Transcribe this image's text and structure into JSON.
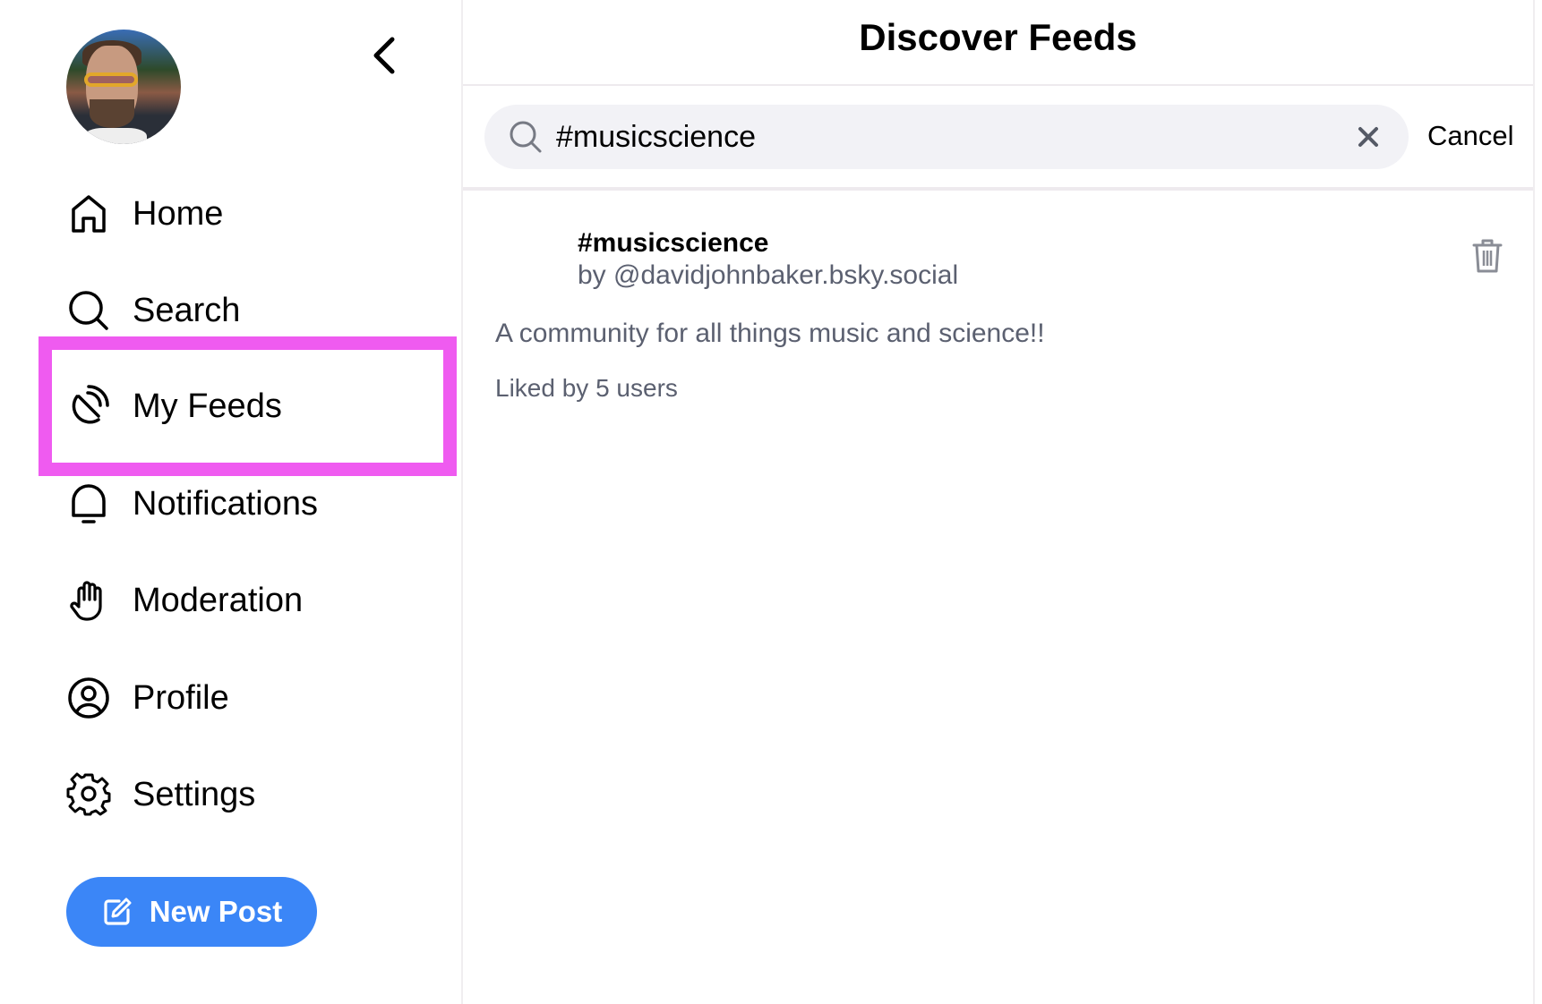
{
  "sidebar": {
    "nav": [
      {
        "label": "Home",
        "icon": "home-icon"
      },
      {
        "label": "Search",
        "icon": "search-icon"
      },
      {
        "label": "My Feeds",
        "icon": "feeds-icon"
      },
      {
        "label": "Notifications",
        "icon": "bell-icon"
      },
      {
        "label": "Moderation",
        "icon": "hand-icon"
      },
      {
        "label": "Profile",
        "icon": "user-circle-icon"
      },
      {
        "label": "Settings",
        "icon": "gear-icon"
      }
    ],
    "new_post_label": "New Post",
    "highlight_color": "#ef5bf0"
  },
  "main": {
    "title": "Discover Feeds",
    "search": {
      "value": "#musicscience"
    },
    "cancel_label": "Cancel",
    "feeds": [
      {
        "name": "#musicscience",
        "author": "by @davidjohnbaker.bsky.social",
        "description": "A community for all things music and science!!",
        "likes": "Liked by 5 users"
      }
    ]
  },
  "colors": {
    "accent": "#3b86f7",
    "muted_text": "#5b6070"
  }
}
